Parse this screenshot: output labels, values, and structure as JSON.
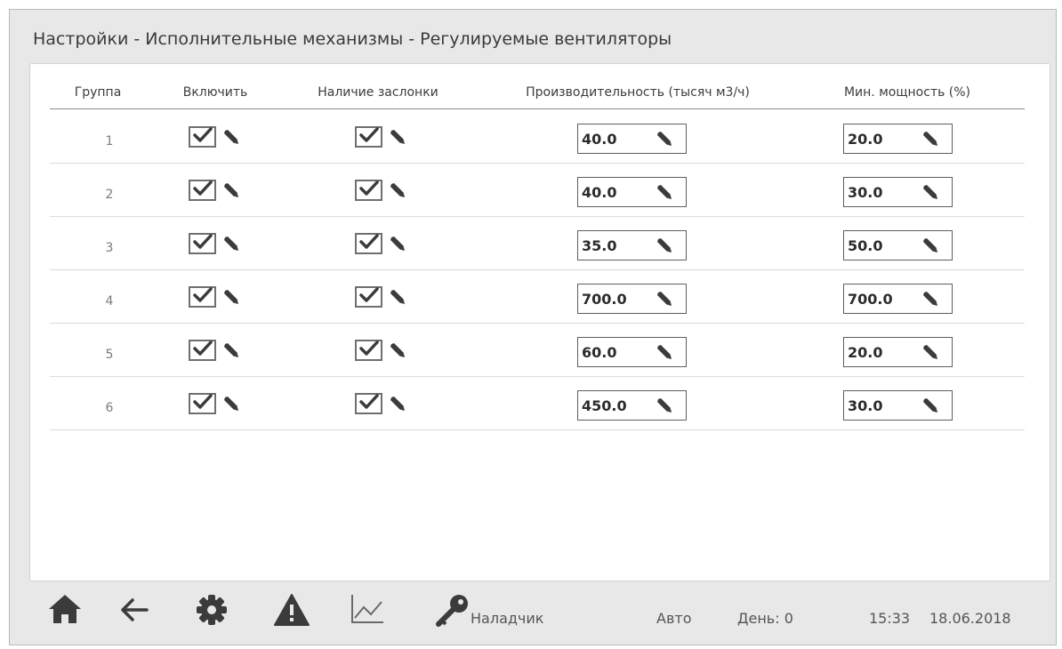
{
  "title": "Настройки - Исполнительные механизмы - Регулируемые вентиляторы",
  "columns": {
    "group": "Группа",
    "enable": "Включить",
    "damper": "Наличие заслонки",
    "capacity": "Производительность (тысяч м3/ч)",
    "min_power": "Мин. мощность (%)"
  },
  "rows": [
    {
      "group": "1",
      "enable": true,
      "damper": true,
      "capacity": "40.0",
      "min_power": "20.0"
    },
    {
      "group": "2",
      "enable": true,
      "damper": true,
      "capacity": "40.0",
      "min_power": "30.0"
    },
    {
      "group": "3",
      "enable": true,
      "damper": true,
      "capacity": "35.0",
      "min_power": "50.0"
    },
    {
      "group": "4",
      "enable": true,
      "damper": true,
      "capacity": "700.0",
      "min_power": "700.0"
    },
    {
      "group": "5",
      "enable": true,
      "damper": true,
      "capacity": "60.0",
      "min_power": "20.0"
    },
    {
      "group": "6",
      "enable": true,
      "damper": true,
      "capacity": "450.0",
      "min_power": "30.0"
    }
  ],
  "footer": {
    "icons": [
      "home-icon",
      "back-arrow-icon",
      "gear-icon",
      "warning-icon",
      "chart-icon",
      "key-icon"
    ],
    "user": "Наладчик",
    "mode": "Авто",
    "day": "День: 0",
    "time": "15:33",
    "date": "18.06.2018"
  }
}
